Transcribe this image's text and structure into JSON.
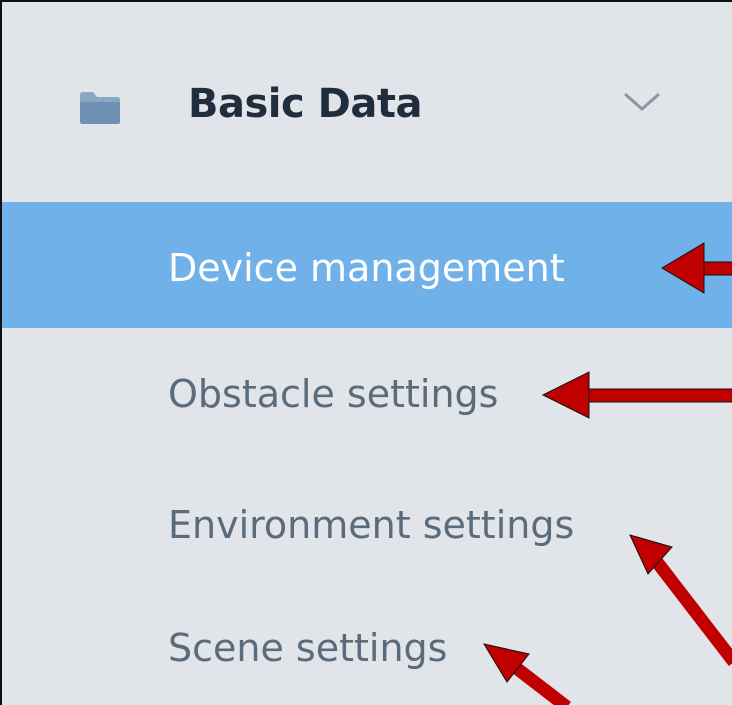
{
  "sidebar": {
    "group": {
      "title": "Basic Data",
      "icon": "folder-icon",
      "toggle_icon": "chevron-down-icon",
      "items": [
        {
          "label": "Device management",
          "active": true
        },
        {
          "label": "Obstacle settings",
          "active": false
        },
        {
          "label": "Environment settings",
          "active": false
        },
        {
          "label": "Scene settings",
          "active": false
        }
      ]
    }
  },
  "colors": {
    "background": "#e1e5e9",
    "active_item": "#71b1ea",
    "title_text": "#1f2d3d",
    "item_text": "#5a6b7c",
    "annotation_arrow": "#c00000"
  }
}
